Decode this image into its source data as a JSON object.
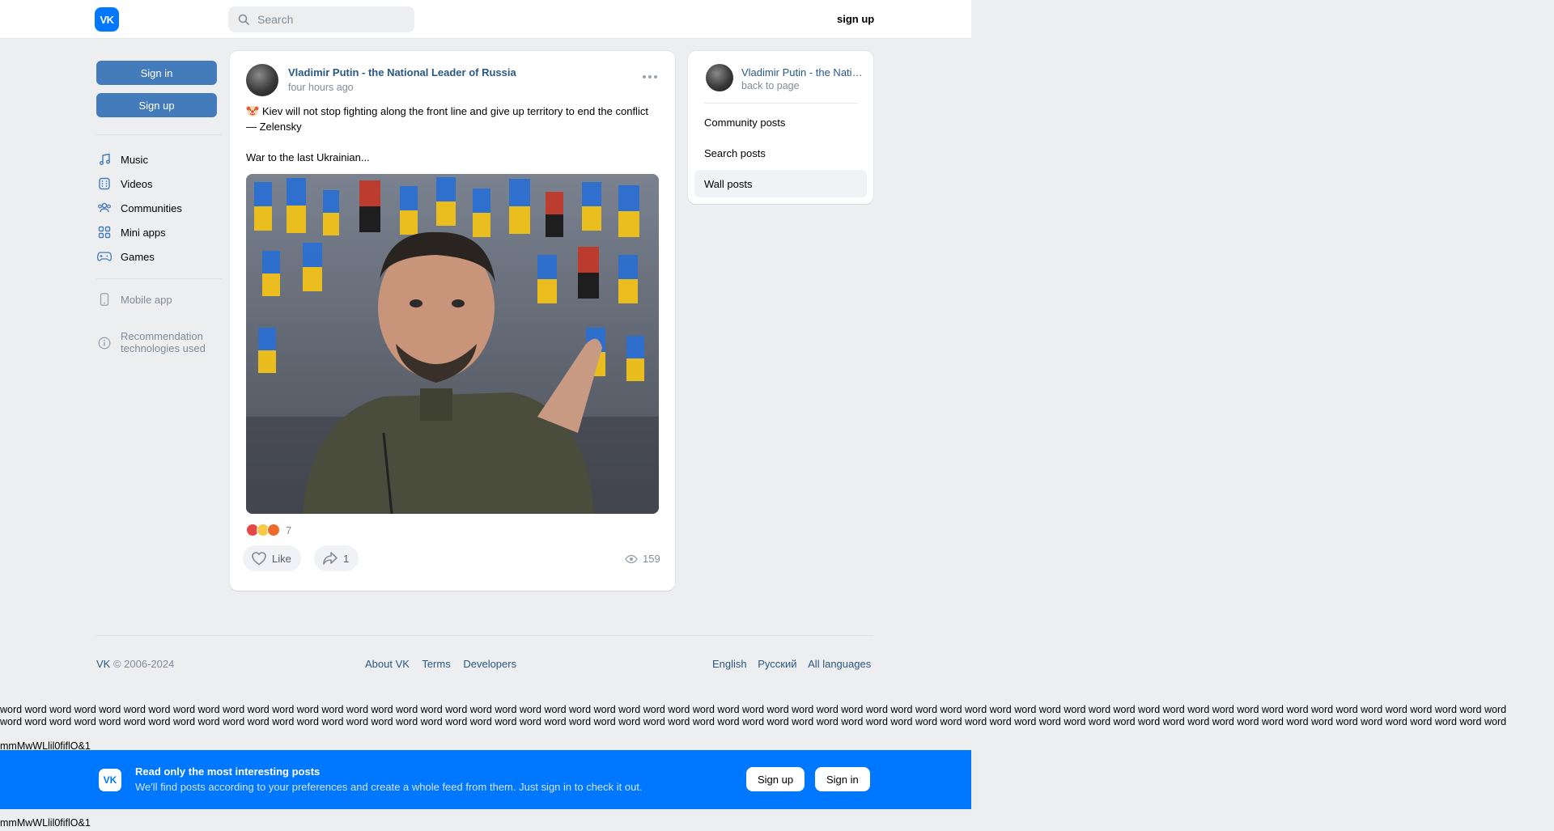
{
  "header": {
    "logo": "VK",
    "search_placeholder": "Search",
    "signup": "sign up"
  },
  "sidebar": {
    "sign_in": "Sign in",
    "sign_up": "Sign up",
    "items": [
      {
        "label": "Music",
        "icon": "music-icon"
      },
      {
        "label": "Videos",
        "icon": "video-icon"
      },
      {
        "label": "Communities",
        "icon": "communities-icon"
      },
      {
        "label": "Mini apps",
        "icon": "mini-apps-icon"
      },
      {
        "label": "Games",
        "icon": "gamepad-icon"
      }
    ],
    "mobile_app": "Mobile app",
    "recommendation_line1": "Recommendation",
    "recommendation_line2": "technologies used"
  },
  "post": {
    "author": "Vladimir Putin - the National Leader of Russia",
    "time": "four hours ago",
    "text_line1": "Kiev will not stop fighting along the front line and give up territory to end the conflict — Zelensky",
    "text_line2": "War to the last Ukrainian...",
    "reactions_count": "7",
    "like_label": "Like",
    "share_count": "1",
    "views": "159"
  },
  "right_card": {
    "name": "Vladimir Putin - the National Leader of Russia",
    "back": "back to page",
    "items": [
      "Community posts",
      "Search posts",
      "Wall posts"
    ],
    "active_item": "Wall posts"
  },
  "footer": {
    "brand": "VK",
    "copyright": " © 2006-2024",
    "links": [
      "About VK",
      "Terms",
      "Developers"
    ],
    "languages": [
      "English",
      "Русский",
      "All languages"
    ]
  },
  "debug_text": {
    "words_line": "word word word word word word word word word word word word word word word word word word word word word word word word word word word word word word word word word word word word word word word word word word word word word word word word word word word word word word word word word word word word word",
    "glyphs": "mmMwWLlil0fiflO&1"
  },
  "banner": {
    "logo": "VK",
    "title": "Read only the most interesting posts",
    "subtitle": "We'll find posts according to your preferences and create a whole feed from them. Just sign in to check it out.",
    "sign_up": "Sign up",
    "sign_in": "Sign in"
  },
  "colors": {
    "accent": "#0077ff",
    "link": "#2a5885",
    "button": "#447bba",
    "background": "#edeef0"
  }
}
